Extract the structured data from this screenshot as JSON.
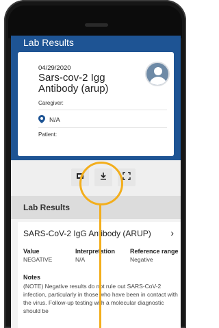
{
  "page": {
    "title": "Lab Results"
  },
  "summary_card": {
    "date": "04/29/2020",
    "test_title": "Sars-cov-2 Igg Antibody (arup)",
    "caregiver_label": "Caregiver:",
    "location": "N/A",
    "patient_label": "Patient:"
  },
  "toolbar": {
    "buttons": [
      "print-icon",
      "download-icon",
      "expand-icon"
    ]
  },
  "results": {
    "section_title": "Lab Results",
    "test_name": "SARS-CoV-2 IgG Antibody (ARUP)",
    "chevron": "›",
    "columns": [
      {
        "header": "Value",
        "value": "NEGATIVE"
      },
      {
        "header": "Interpretation",
        "value": "N/A"
      },
      {
        "header": "Reference range",
        "value": "Negative"
      }
    ],
    "notes_header": "Notes",
    "notes_text": "(NOTE) Negative results do not rule out SARS-CoV-2 infection, particularly in those who have been in contact with the virus. Follow-up testing with a molecular diagnostic should be"
  },
  "colors": {
    "primary": "#1e5494",
    "highlight": "#f3ae1c"
  }
}
